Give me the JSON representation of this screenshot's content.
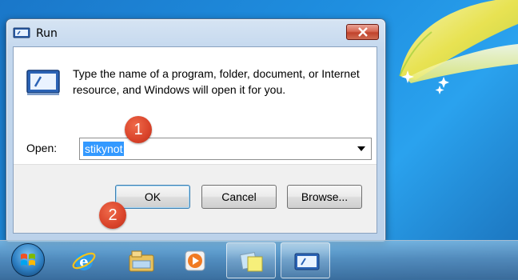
{
  "dialog": {
    "title": "Run",
    "description": "Type the name of a program, folder, document, or Internet resource, and Windows will open it for you.",
    "open_label": "Open:",
    "open_value": "stikynot",
    "buttons": {
      "ok": "OK",
      "cancel": "Cancel",
      "browse": "Browse..."
    }
  },
  "markers": [
    "1",
    "2"
  ],
  "taskbar": {
    "items": [
      "windows-start-icon",
      "internet-explorer-icon",
      "windows-explorer-icon",
      "media-player-icon",
      "sticky-notes-icon",
      "run-icon"
    ]
  },
  "colors": {
    "accent_marker": "#d9432a",
    "selection": "#3399ff"
  }
}
